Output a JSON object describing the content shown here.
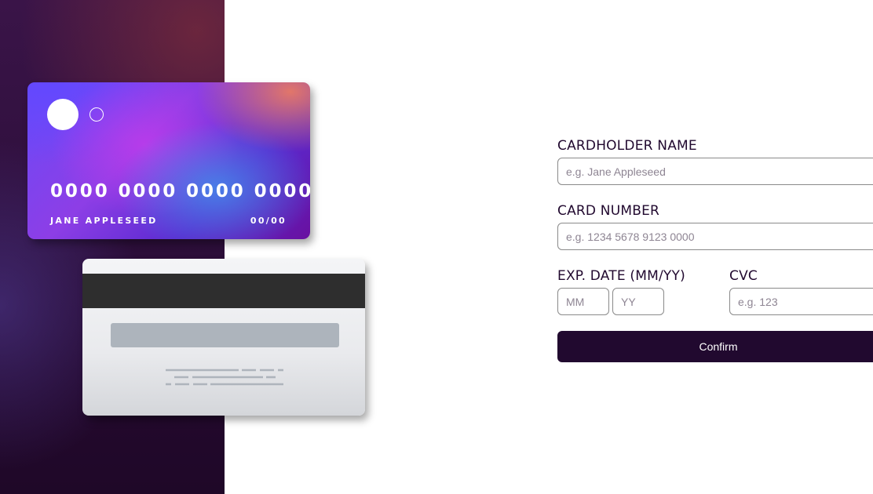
{
  "card_front": {
    "number": "0000 0000 0000 0000",
    "holder": "JANE APPLESEED",
    "expiry": "00/00"
  },
  "card_back": {
    "cvc": ""
  },
  "form": {
    "cardholder_name": {
      "label": "CARDHOLDER NAME",
      "placeholder": "e.g. Jane Appleseed",
      "value": ""
    },
    "card_number": {
      "label": "CARD NUMBER",
      "placeholder": "e.g. 1234 5678 9123 0000",
      "value": ""
    },
    "exp_date": {
      "label": "EXP. DATE (MM/YY)",
      "month_placeholder": "MM",
      "year_placeholder": "YY"
    },
    "cvc": {
      "label": "CVC",
      "placeholder": "e.g. 123",
      "value": ""
    },
    "confirm_label": "Confirm"
  },
  "colors": {
    "dark_violet": "#21092f",
    "input_border": "#8a8a8a",
    "sidebar_top": "#3a1448",
    "sidebar_bottom": "#1f0828",
    "magnetic_strip": "#2e2e2e"
  }
}
